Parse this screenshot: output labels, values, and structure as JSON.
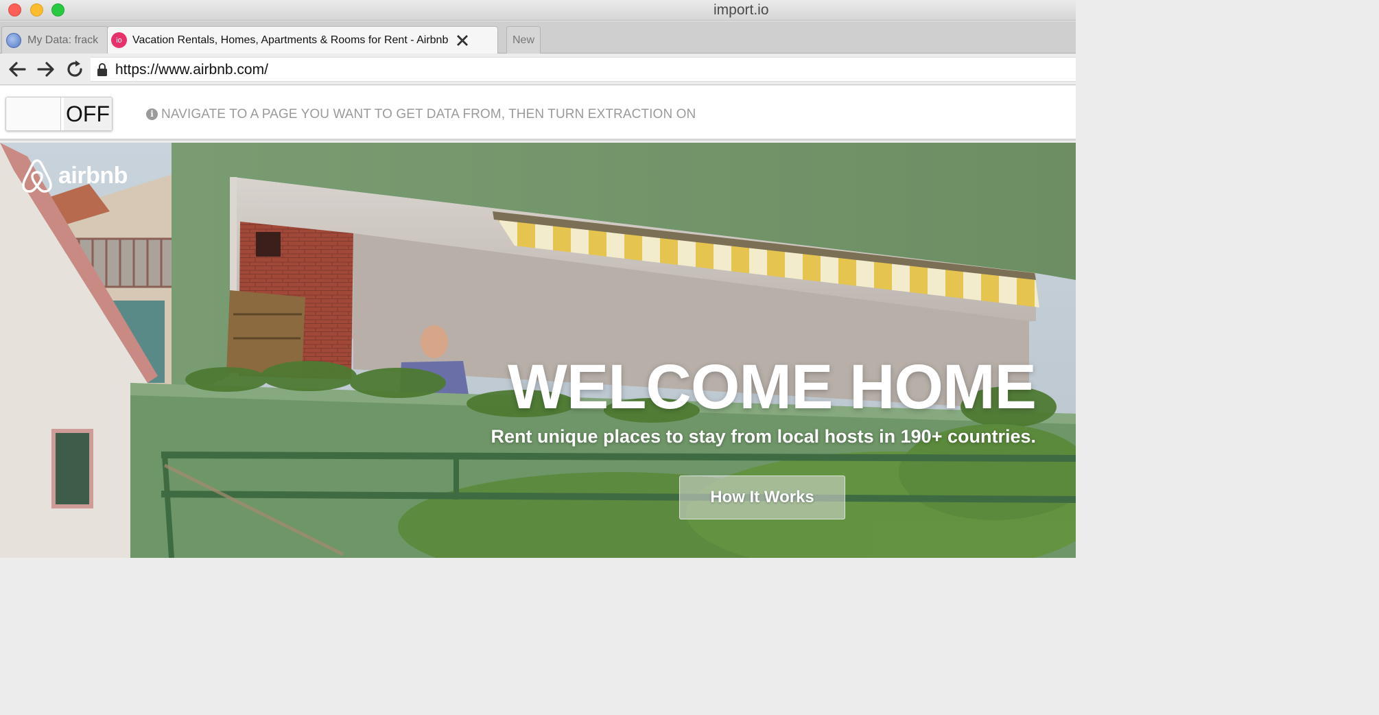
{
  "window": {
    "title": "import.io"
  },
  "tabs": [
    {
      "label": "My Data: frack",
      "icon": "globe-icon"
    },
    {
      "label": "Vacation Rentals, Homes, Apartments & Rooms for Rent - Airbnb",
      "icon": "io-icon",
      "icon_text": "io"
    },
    {
      "label": "New"
    }
  ],
  "navbar": {
    "url": "https://www.airbnb.com/"
  },
  "extraction": {
    "toggle_label": "OFF",
    "message": "NAVIGATE TO A PAGE YOU WANT TO GET DATA FROM, THEN TURN EXTRACTION ON"
  },
  "page": {
    "logo_text": "airbnb",
    "headline": "WELCOME HOME",
    "subheadline": "Rent unique places to stay from local hosts in 190+ countries.",
    "cta_label": "How It Works"
  },
  "colors": {
    "brand": "#ff5a5f",
    "io_pink": "#e8306b",
    "hero_green": "#6f9668"
  }
}
